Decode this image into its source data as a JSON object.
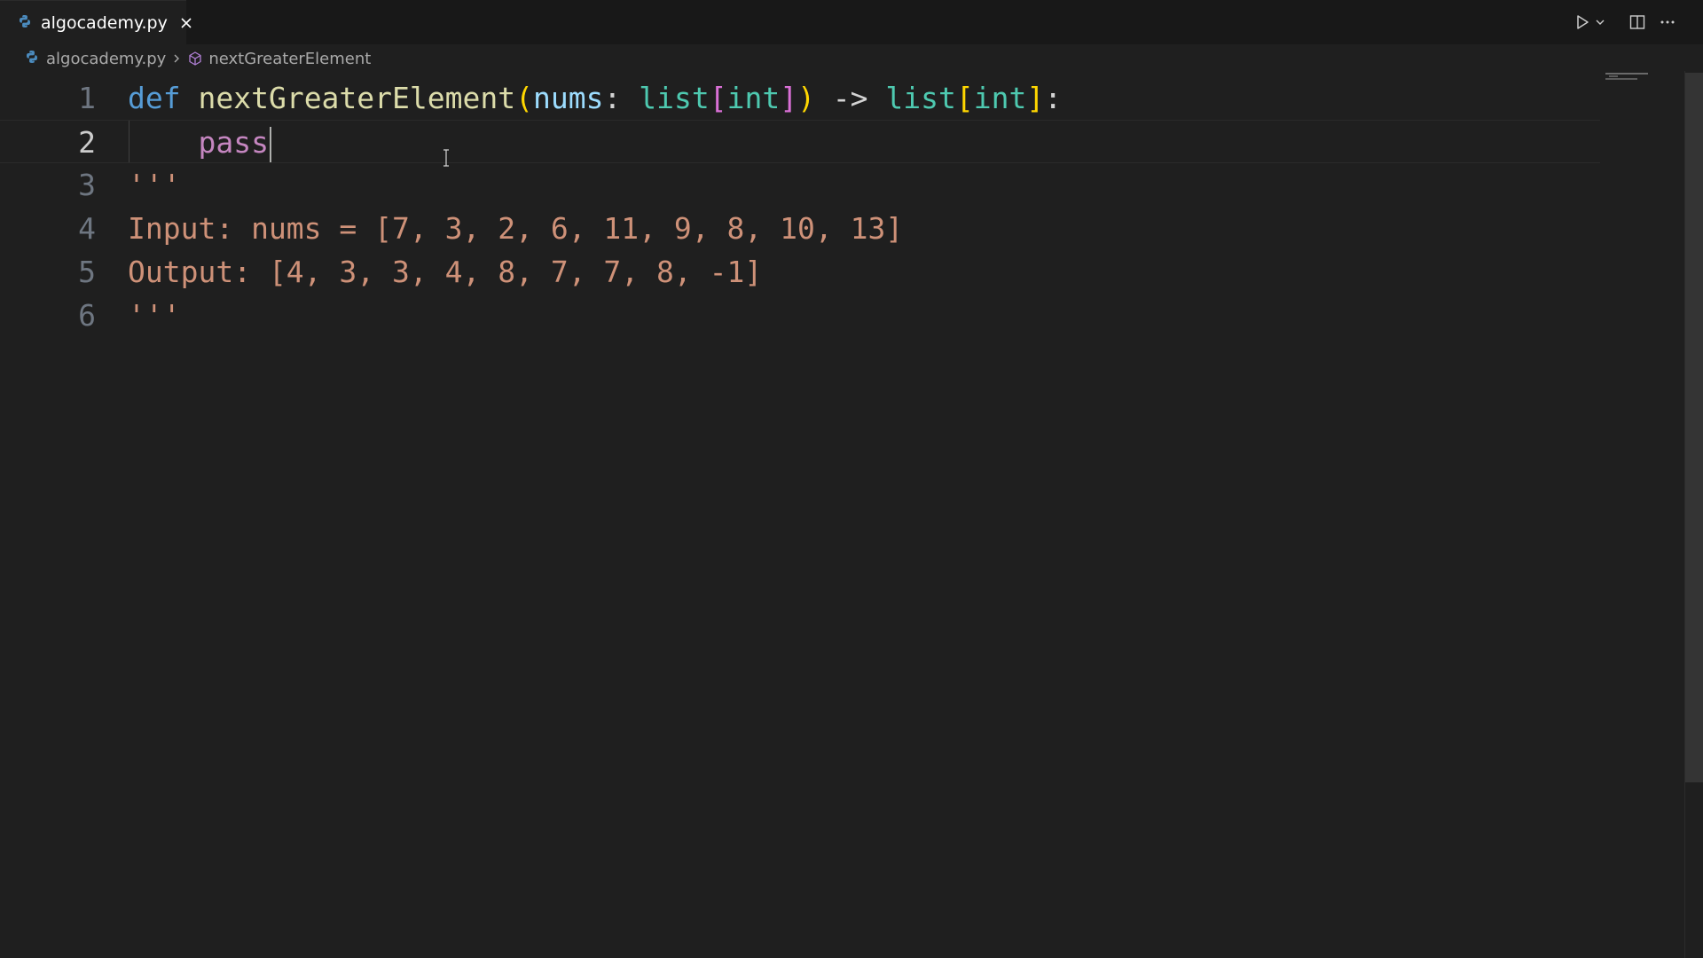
{
  "tab": {
    "filename": "algocademy.py"
  },
  "breadcrumb": {
    "file": "algocademy.py",
    "symbol": "nextGreaterElement"
  },
  "editor": {
    "current_line": 2,
    "lines": [
      {
        "number": "1",
        "tokens": [
          {
            "text": "def",
            "cls": "kw-def"
          },
          {
            "text": " ",
            "cls": "punc"
          },
          {
            "text": "nextGreaterElement",
            "cls": "fn"
          },
          {
            "text": "(",
            "cls": "paren"
          },
          {
            "text": "nums",
            "cls": "param"
          },
          {
            "text": ": ",
            "cls": "punc"
          },
          {
            "text": "list",
            "cls": "type"
          },
          {
            "text": "[",
            "cls": "br2"
          },
          {
            "text": "int",
            "cls": "type"
          },
          {
            "text": "]",
            "cls": "br2"
          },
          {
            "text": ")",
            "cls": "paren"
          },
          {
            "text": " -> ",
            "cls": "punc"
          },
          {
            "text": "list",
            "cls": "type"
          },
          {
            "text": "[",
            "cls": "paren"
          },
          {
            "text": "int",
            "cls": "type"
          },
          {
            "text": "]",
            "cls": "paren"
          },
          {
            "text": ":",
            "cls": "punc"
          }
        ]
      },
      {
        "number": "2",
        "tokens": [
          {
            "text": "    ",
            "cls": "punc"
          },
          {
            "text": "pass",
            "cls": "kw-ctrl"
          }
        ]
      },
      {
        "number": "3",
        "tokens": [
          {
            "text": "'''",
            "cls": "str"
          }
        ]
      },
      {
        "number": "4",
        "tokens": [
          {
            "text": "Input: nums = [7, 3, 2, 6, 11, 9, 8, 10, 13]",
            "cls": "str"
          }
        ]
      },
      {
        "number": "5",
        "tokens": [
          {
            "text": "Output: [4, 3, 3, 4, 8, 7, 7, 8, -1]",
            "cls": "str"
          }
        ]
      },
      {
        "number": "6",
        "tokens": [
          {
            "text": "'''",
            "cls": "str"
          }
        ]
      }
    ]
  },
  "icons": {
    "tab_file": "python-file-icon",
    "tab_close": "close-icon",
    "run": "play-icon",
    "run_menu": "chevron-down-icon",
    "split": "split-editor-icon",
    "more": "more-actions-icon",
    "breadcrumb_separator": "chevron-right-icon",
    "symbol": "method-cube-icon"
  },
  "colors": {
    "editor_bg": "#1f1f1f",
    "tabbar_bg": "#181818",
    "keyword": "#569cd6",
    "function": "#dcdcaa",
    "parameter": "#9cdcfe",
    "type": "#4ec9b0",
    "string": "#ce9178",
    "control_keyword": "#c586c0",
    "bracket_gold": "#ffd700",
    "bracket_orchid": "#da70d6"
  }
}
